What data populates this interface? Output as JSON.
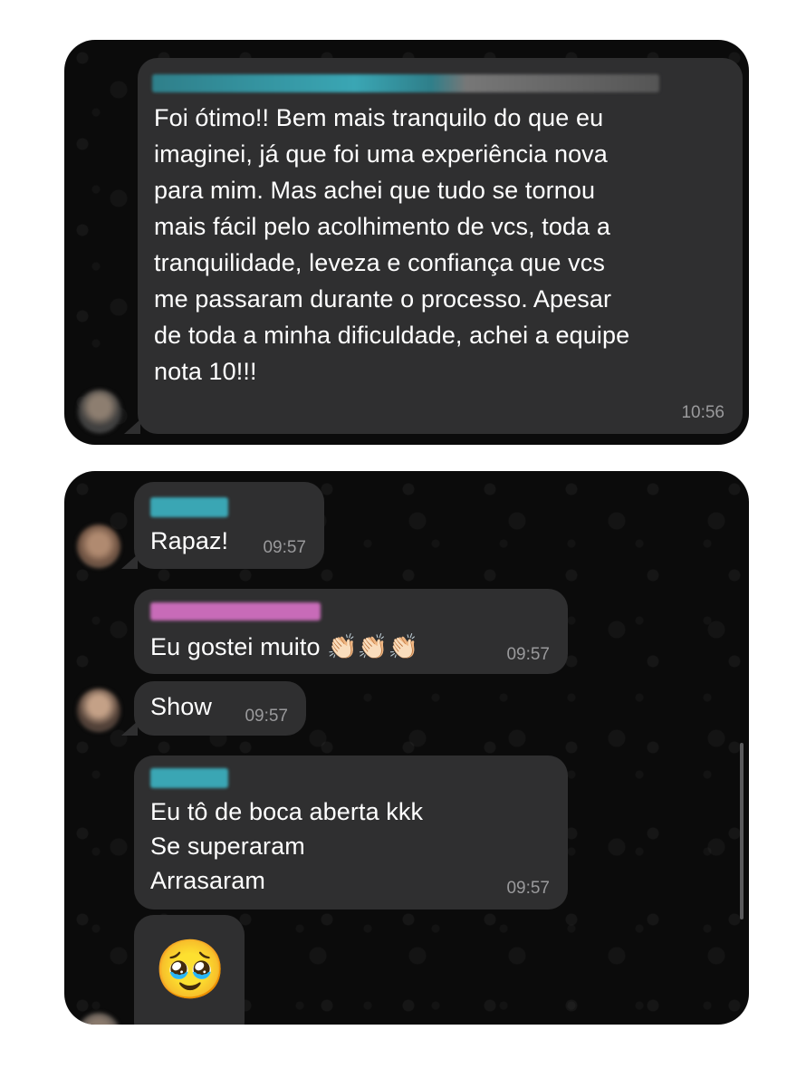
{
  "chat1": {
    "message": "Foi ótimo!! Bem mais tranquilo do que eu imaginei, já que foi uma experiência nova para mim. Mas achei que tudo se tornou mais fácil pelo acolhimento de vcs, toda a tranquilidade, leveza e confiança que vcs me passaram durante o processo. Apesar de toda a minha dificuldade, achei a equipe nota 10!!!",
    "time": "10:56"
  },
  "chat2": {
    "messages": [
      {
        "text": "Rapaz!",
        "time": "09:57"
      },
      {
        "text": "Eu gostei muito 👏🏻👏🏻👏🏻",
        "time": "09:57"
      },
      {
        "text": "Show",
        "time": "09:57"
      },
      {
        "lines": [
          "Eu tô de boca aberta kkk",
          "Se superaram",
          "Arrasaram"
        ],
        "time": "09:57"
      },
      {
        "emoji": "🥹"
      }
    ]
  },
  "colors": {
    "panel_bg": "#0b0b0b",
    "bubble_bg": "#2f2f30",
    "timestamp": "#9a9a9c",
    "sender_blur_teal": "#3aa6b4",
    "sender_blur_pink": "#c86bb8"
  }
}
